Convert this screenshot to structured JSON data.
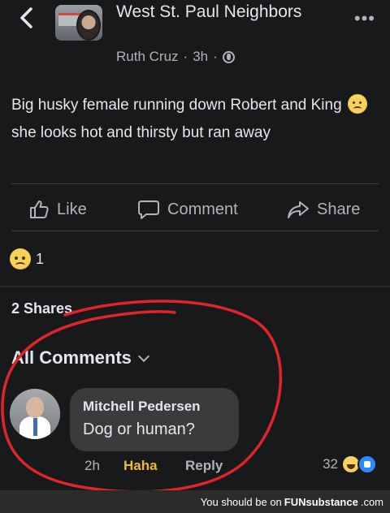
{
  "header": {
    "group_name": "West St. Paul Neighbors",
    "author": "Ruth Cruz",
    "separator": "·",
    "time": "3h",
    "icons": {
      "back": "chevron-left-icon",
      "privacy": "globe-icon",
      "more": "more-dots-icon"
    },
    "more_label": "•••"
  },
  "post": {
    "text_before_emoji": "Big husky female running down Robert and King ",
    "emoji": "sad-face-emoji",
    "text_after_emoji": "she looks hot and thirsty but ran away"
  },
  "actions": {
    "like": "Like",
    "comment": "Comment",
    "share": "Share"
  },
  "reactions": {
    "emoji": "sad-face-emoji",
    "count": "1"
  },
  "shares": "2 Shares",
  "comments_header": "All Comments",
  "comment": {
    "author": "Mitchell Pedersen",
    "text": "Dog or human?",
    "time": "2h",
    "reaction_label": "Haha",
    "reply_label": "Reply",
    "reaction_count": "32"
  },
  "annotation_color": "#e0242b",
  "watermark": {
    "prefix": "You should be on",
    "brand": "FUNsubstance",
    "suffix": ".com"
  }
}
